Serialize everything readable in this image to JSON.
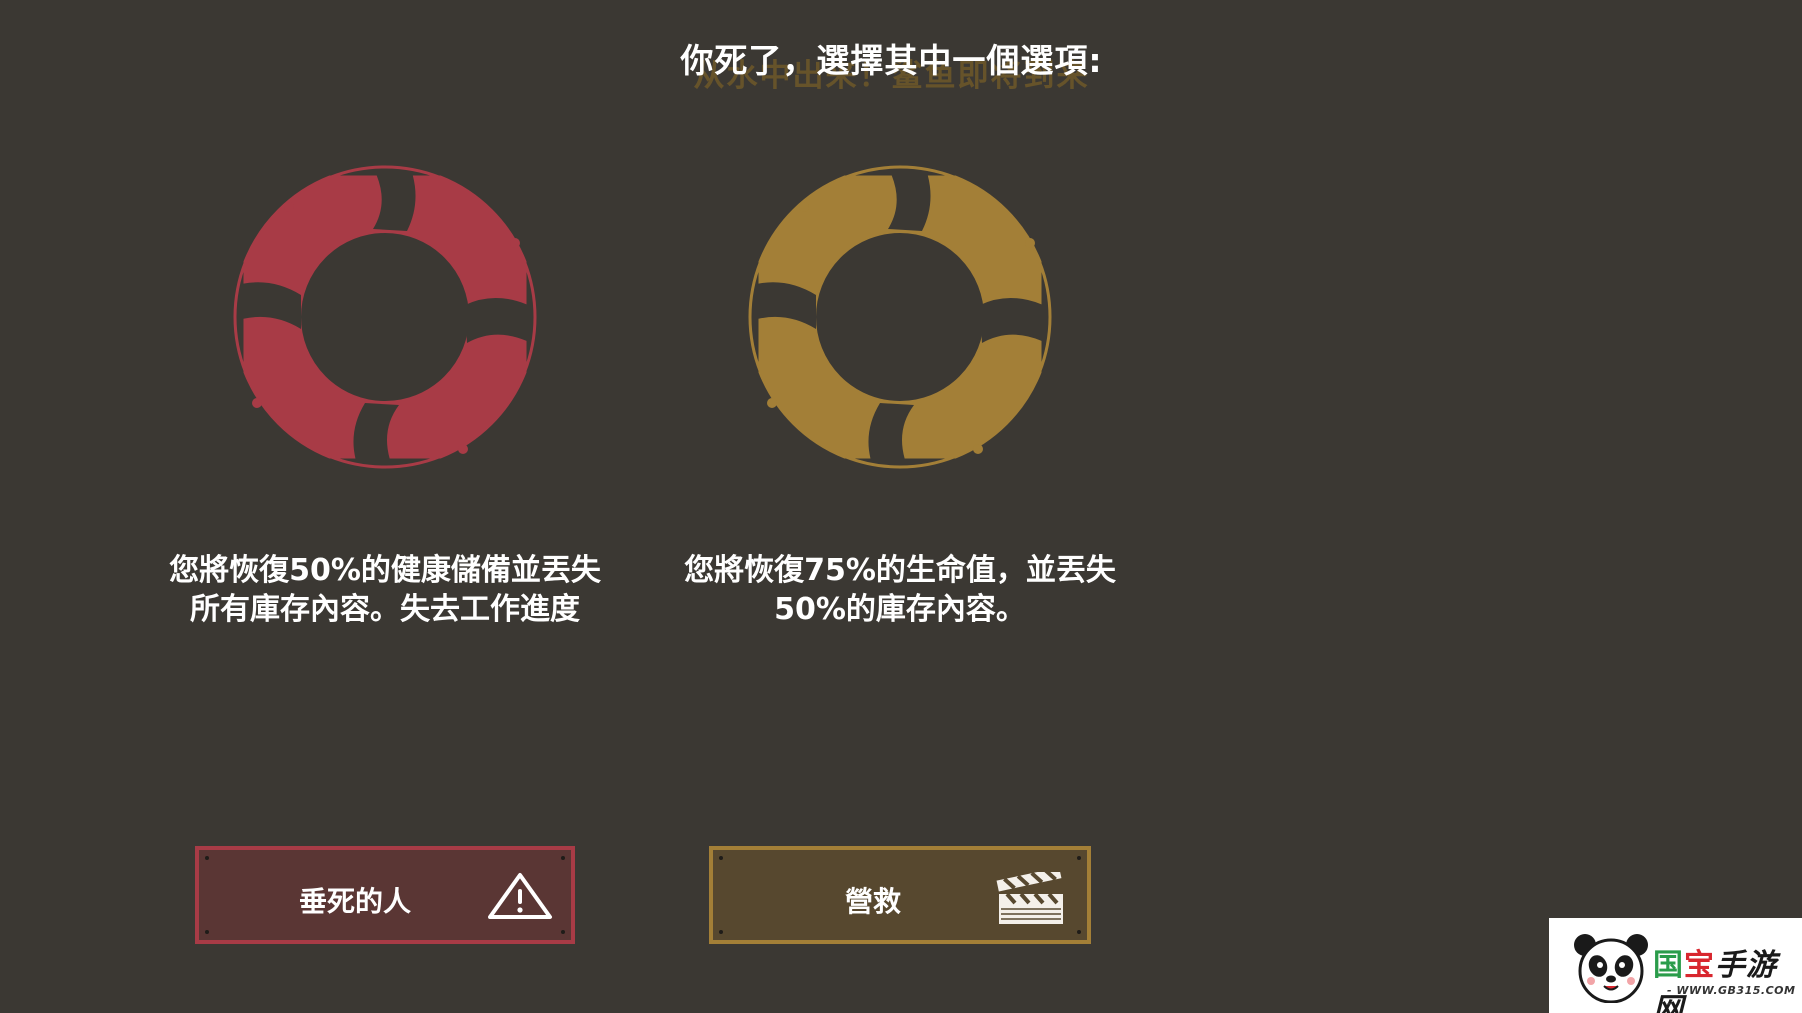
{
  "screen": {
    "ghost_text": "从水中出来！鲨鱼即将到来",
    "title": "你死了，選擇其中一個選項:"
  },
  "options": [
    {
      "icon": "lifebuoy-icon",
      "color": "#a83b46",
      "description": "您將恢復50%的健康儲備並丟失所有庫存內容。失去工作進度",
      "button_label": "垂死的人",
      "button_icon": "warning-triangle-icon"
    },
    {
      "icon": "lifebuoy-icon",
      "color": "#a37f37",
      "description": "您將恢復75%的生命值，並丟失50%的庫存內容。",
      "button_label": "營救",
      "button_icon": "clapperboard-icon"
    }
  ],
  "watermark": {
    "brand_part1": "国",
    "brand_part2": "宝",
    "brand_part3": "手游网",
    "url": "- WWW.GB315.COM -"
  }
}
